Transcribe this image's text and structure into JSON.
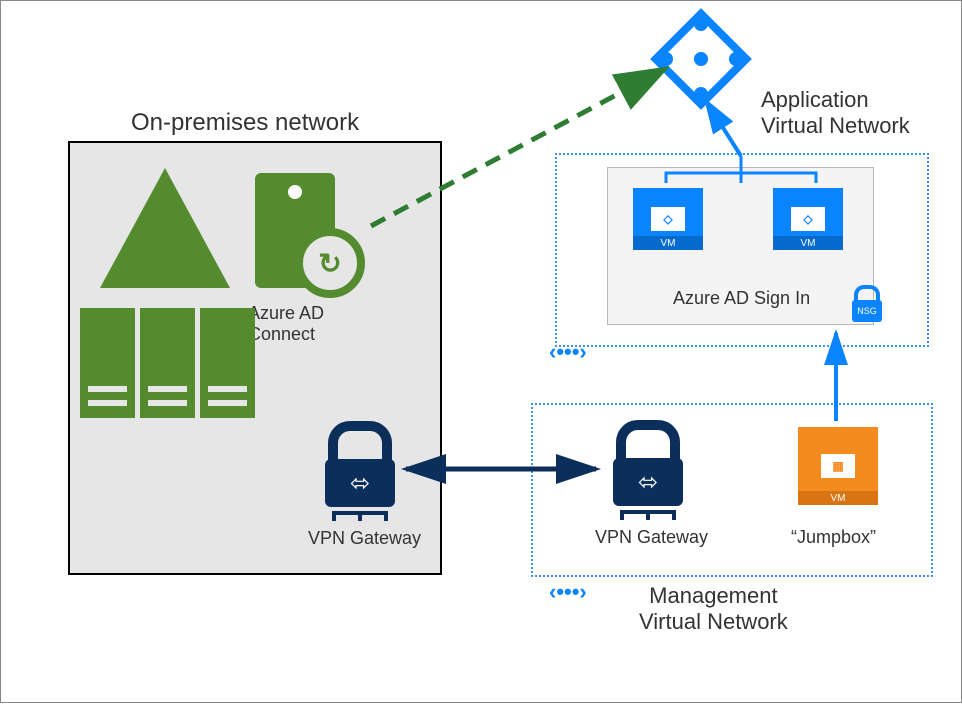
{
  "diagram": {
    "title_onprem": "On-premises network",
    "title_app_line1": "Application",
    "title_app_line2": "Virtual Network",
    "title_mgmt_line1": "Management",
    "title_mgmt_line2": "Virtual Network",
    "aad_connect_line1": "Azure AD",
    "aad_connect_line2": "Connect",
    "vpn_gateway_onprem": "VPN Gateway",
    "vpn_gateway_mgmt": "VPN Gateway",
    "jumpbox_label": "“Jumpbox”",
    "azure_ad_signin": "Azure AD Sign In",
    "nsg_label": "NSG",
    "vm_label": "VM",
    "peer_glyph": "‹•••›",
    "icons": {
      "triangle": "onprem-ad-icon",
      "server": "server-icon",
      "drive": "storage-drive-icon",
      "sync": "sync-icon",
      "vpn": "vpn-gateway-icon",
      "vm_blue": "vm-icon",
      "vm_orange": "vm-jumpbox-icon",
      "nsg": "nsg-lock-icon",
      "aad": "azure-ad-icon",
      "peer": "vnet-peering-icon"
    },
    "colors": {
      "green": "#558b2f",
      "navy": "#0b2e5a",
      "blue": "#0a84ff",
      "orange": "#f58a1f",
      "bg_onprem": "#e6e6e6"
    },
    "connections": [
      {
        "from": "Azure AD Connect",
        "to": "Azure AD (cloud)",
        "style": "dashed-green",
        "direction": "one-way"
      },
      {
        "from": "On-prem VPN Gateway",
        "to": "Management VPN Gateway",
        "style": "solid-navy",
        "direction": "two-way"
      },
      {
        "from": "Azure AD Sign In VMs",
        "to": "Azure AD (cloud)",
        "style": "solid-blue",
        "direction": "one-way"
      },
      {
        "from": "Jumpbox VM",
        "to": "Application VNet NSG",
        "style": "solid-blue",
        "direction": "one-way"
      }
    ]
  }
}
